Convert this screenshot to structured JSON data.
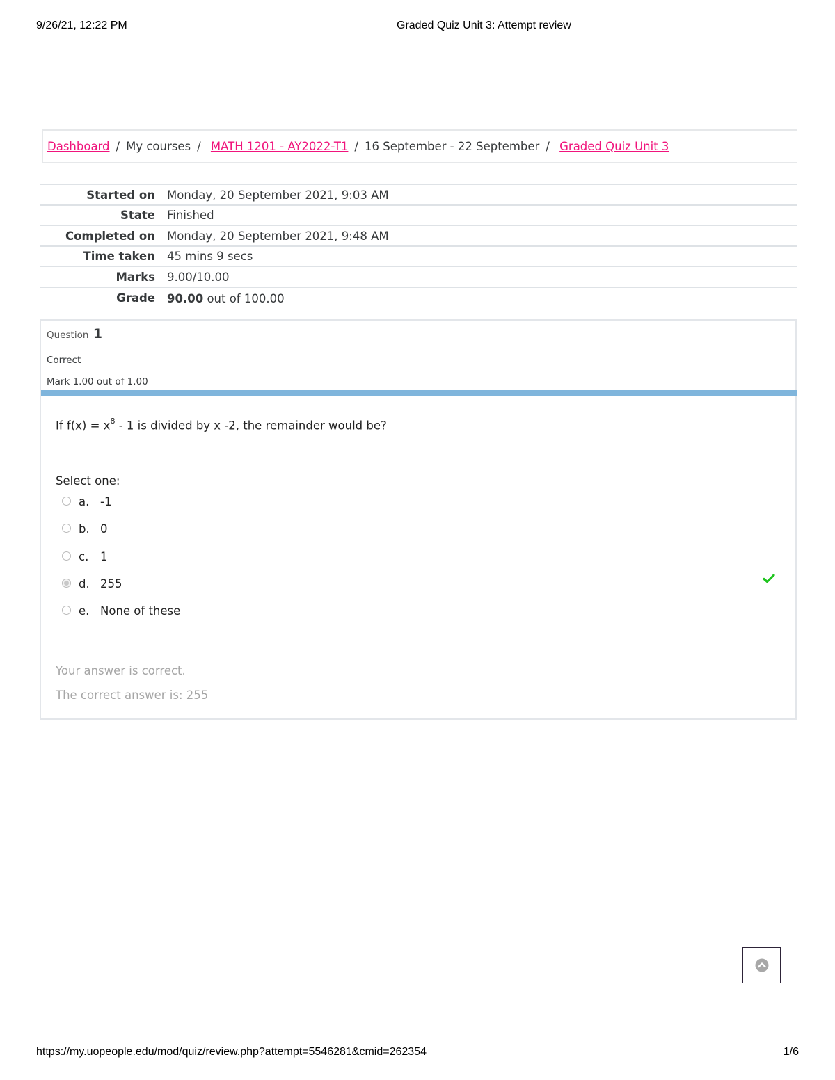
{
  "print_header": {
    "datetime": "9/26/21, 12:22 PM",
    "title": "Graded Quiz Unit 3: Attempt review"
  },
  "breadcrumb": {
    "items": [
      {
        "label": "Dashboard",
        "link": true
      },
      {
        "label": "My courses",
        "link": false
      },
      {
        "label": "MATH 1201 - AY2022-T1",
        "link": true
      },
      {
        "label": "16 September - 22 September",
        "link": false
      },
      {
        "label": "Graded Quiz Unit 3",
        "link": true
      }
    ],
    "separator": "/",
    "link_color": "#f0147c"
  },
  "summary": {
    "rows": [
      {
        "label": "Started on",
        "value": "Monday, 20 September 2021, 9:03 AM"
      },
      {
        "label": "State",
        "value": "Finished"
      },
      {
        "label": "Completed on",
        "value": "Monday, 20 September 2021, 9:48 AM"
      },
      {
        "label": "Time taken",
        "value": "45 mins 9 secs"
      },
      {
        "label": "Marks",
        "value": "9.00/10.00"
      },
      {
        "label": "Grade",
        "value_bold": "90.00",
        "value": " out of 100.00"
      }
    ]
  },
  "question": {
    "label": "Question",
    "number": "1",
    "state": "Correct",
    "mark": "Mark 1.00 out of 1.00",
    "bar_color": "#7fb5dc",
    "text_before": "If f(x) = x",
    "text_sup": "8",
    "text_after": " - 1 is divided by x -2, the remainder would be?",
    "prompt": "Select one:",
    "answers": [
      {
        "letter": "a.",
        "text": "-1",
        "selected": false,
        "correct": false
      },
      {
        "letter": "b.",
        "text": "0",
        "selected": false,
        "correct": false
      },
      {
        "letter": "c.",
        "text": "1",
        "selected": false,
        "correct": false
      },
      {
        "letter": "d.",
        "text": "255",
        "selected": true,
        "correct": true
      },
      {
        "letter": "e.",
        "text": "None of these",
        "selected": false,
        "correct": false
      }
    ],
    "correct_icon": "check-icon",
    "correct_color": "#1ec41e",
    "feedback": "Your answer is correct.",
    "right_answer": "The correct answer is: 255"
  },
  "scroll_top": {
    "icon": "chevron-up-circle-icon"
  },
  "print_footer": {
    "url": "https://my.uopeople.edu/mod/quiz/review.php?attempt=5546281&cmid=262354",
    "page": "1/6"
  }
}
